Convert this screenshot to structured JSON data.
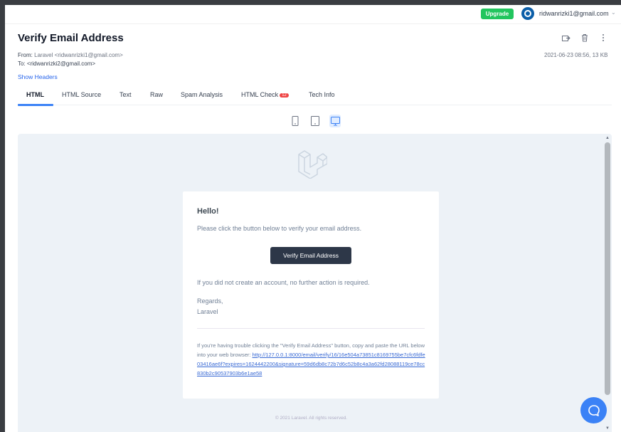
{
  "colors": {
    "accent": "#3b82f6",
    "upgrade": "#22c55e",
    "badge": "#ef4444",
    "preview_bg": "#edf2f7",
    "email_button": "#2d3748",
    "link": "#3869d4"
  },
  "topbar": {
    "upgrade_label": "Upgrade",
    "user_email": "ridwanrizki1@gmail.com",
    "caret": "⌄",
    "avatar_icon": "user-ring-icon"
  },
  "message": {
    "subject": "Verify Email Address",
    "from_label": "From:",
    "from_value": "Laravel <ridwanrizki1@gmail.com>",
    "to_label": "To:",
    "to_value": "<ridwanrizki2@gmail.com>",
    "meta": "2021-06-23 08:56, 13 KB",
    "show_headers": "Show Headers",
    "actions": [
      "forward-icon",
      "trash-icon",
      "more-vertical-icon"
    ]
  },
  "tabs": [
    {
      "label": "HTML",
      "active": true
    },
    {
      "label": "HTML Source"
    },
    {
      "label": "Text"
    },
    {
      "label": "Raw"
    },
    {
      "label": "Spam Analysis"
    },
    {
      "label": "HTML Check",
      "badge": "12"
    },
    {
      "label": "Tech Info"
    }
  ],
  "devices": [
    {
      "icon": "mobile-icon"
    },
    {
      "icon": "tablet-icon"
    },
    {
      "icon": "desktop-icon",
      "active": true
    }
  ],
  "email": {
    "greeting": "Hello!",
    "intro": "Please click the button below to verify your email address.",
    "button": "Verify Email Address",
    "no_action": "If you did not create an account, no further action is required.",
    "regards": "Regards,",
    "sender": "Laravel",
    "subcopy_text": "If you're having trouble clicking the \"Verify Email Address\" button, copy and paste the URL below into your web browser: ",
    "subcopy_link": "http://127.0.0.1:8000/email/verify/16/16e504a73851c8169755be7cfc6fdfe03416ae6f?expires=1624442200&signature=59d6db8c72b7d6c52b8c4a3a62fd28088119ce78cc830b2c90537903b6e1ae58",
    "footer": "© 2021 Laravel. All rights reserved."
  },
  "chat": {
    "icon": "chat-bubble-icon"
  }
}
